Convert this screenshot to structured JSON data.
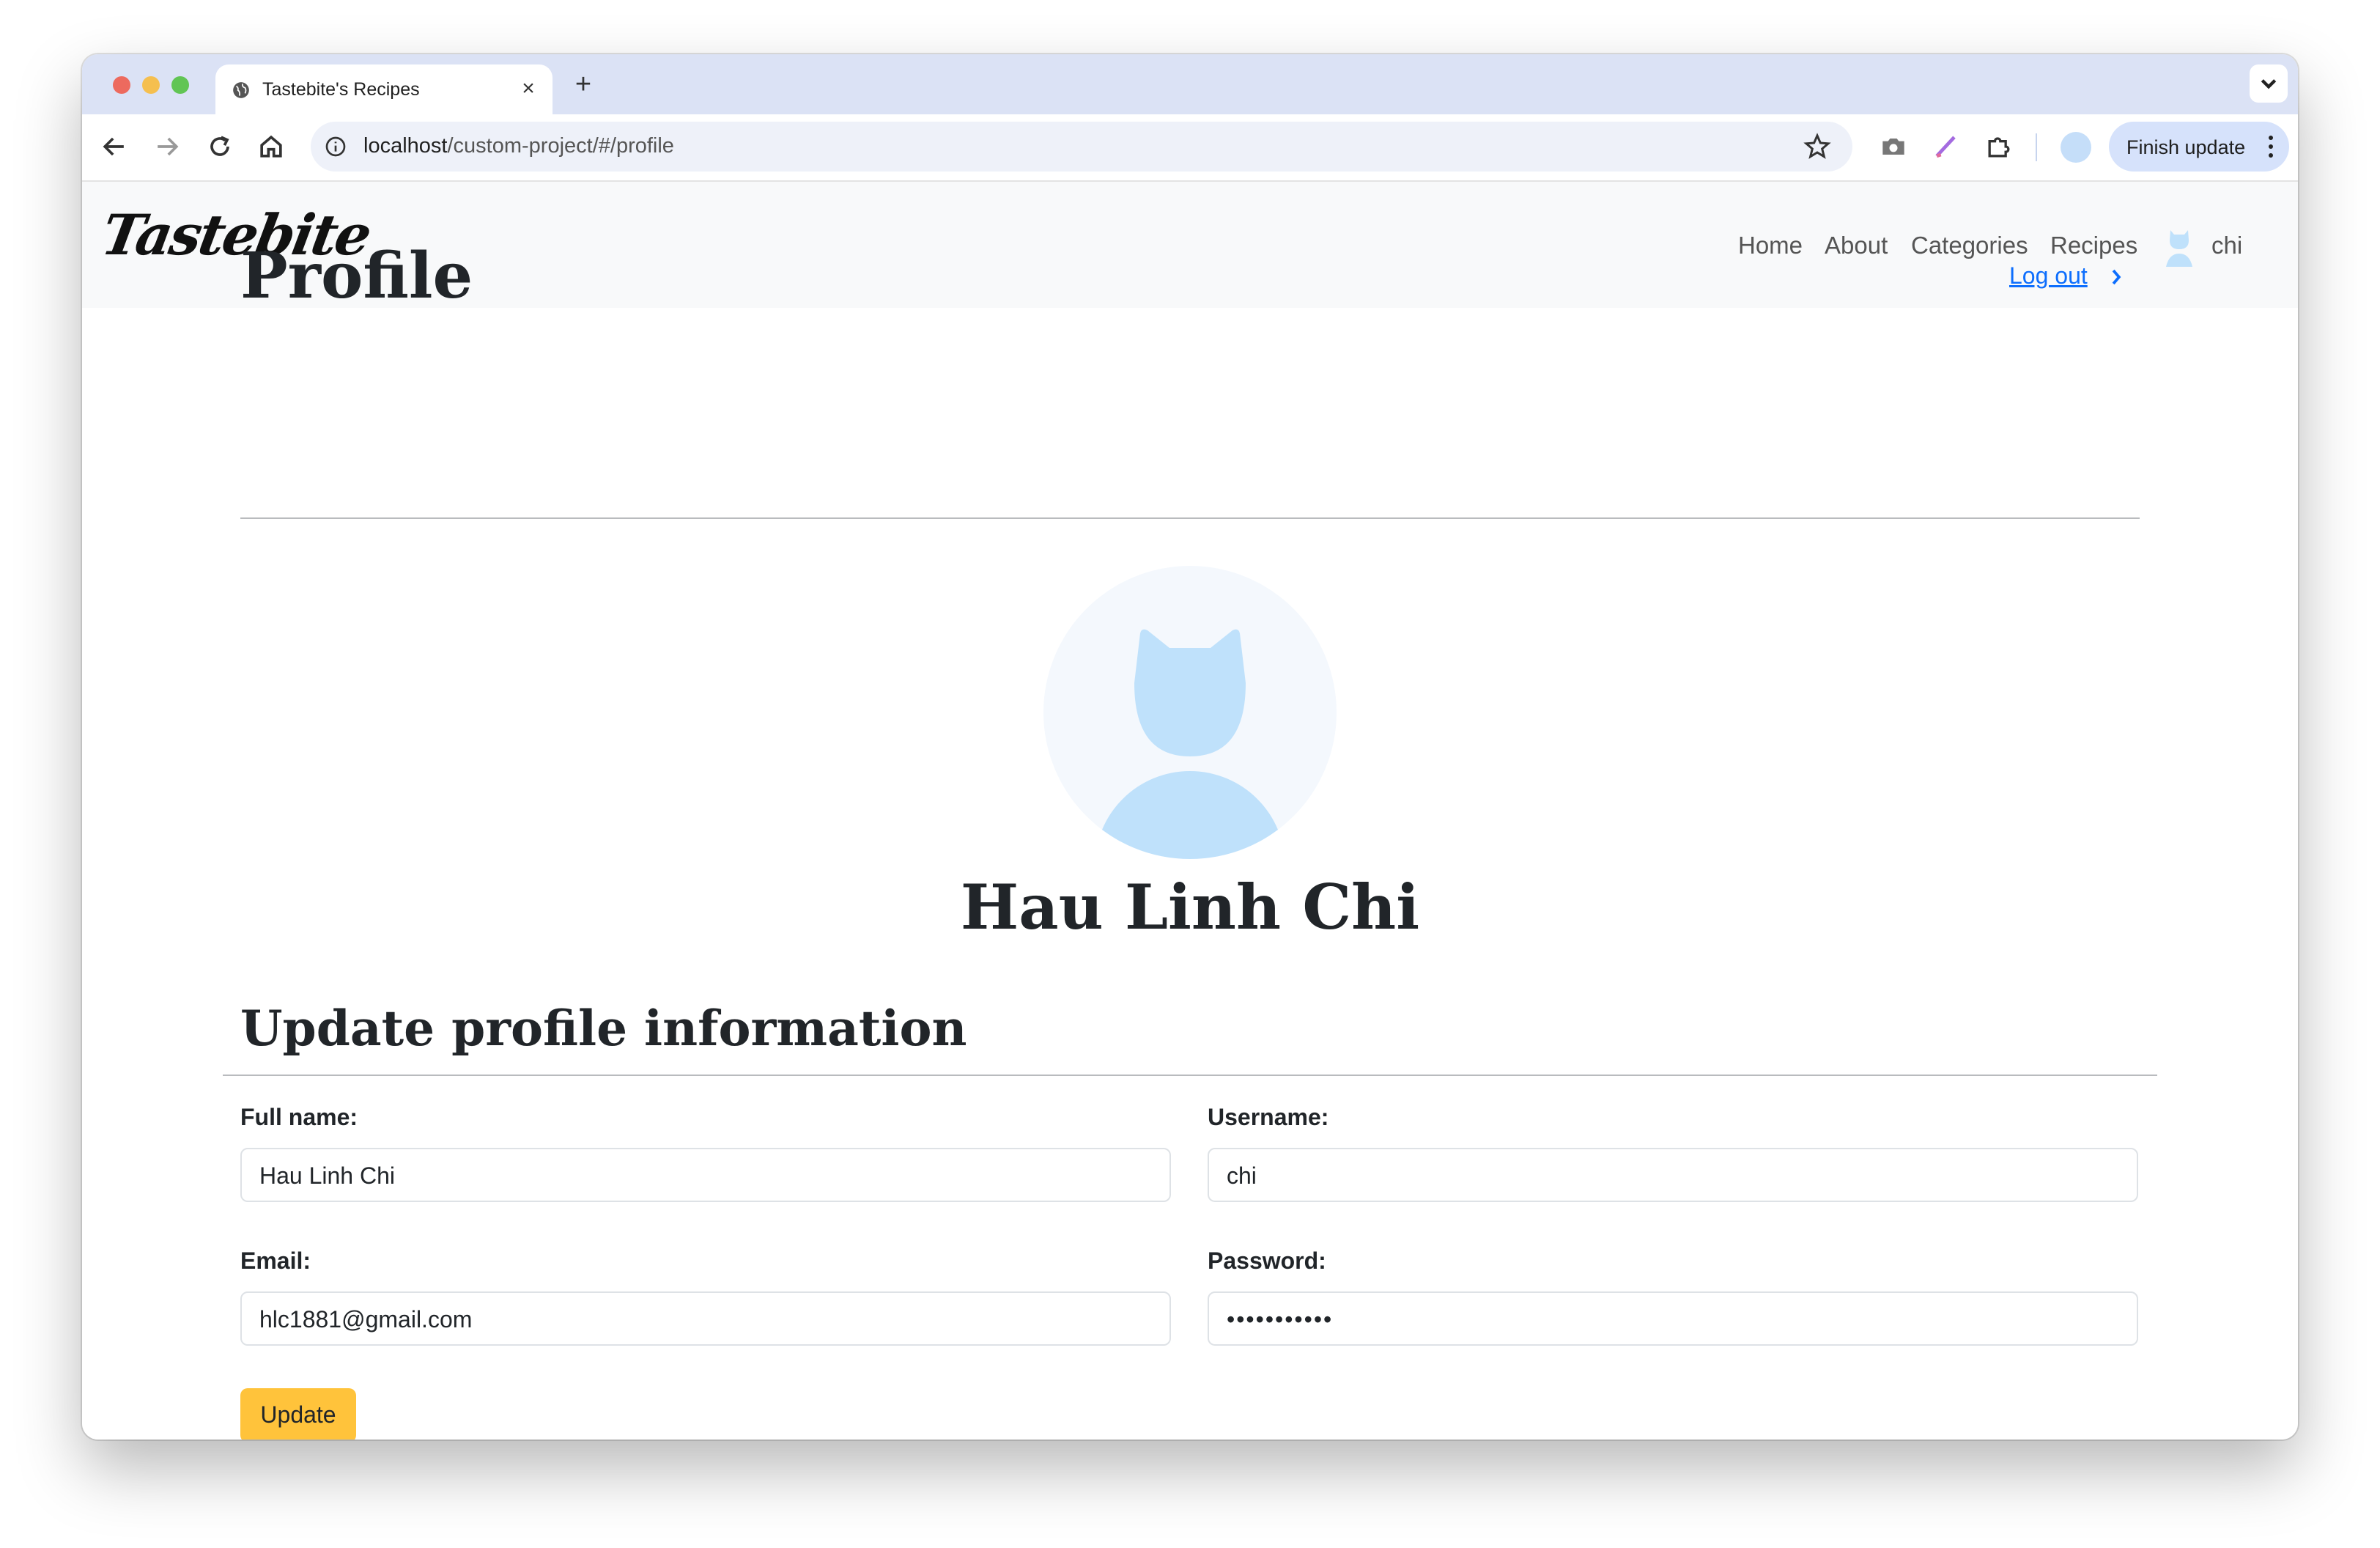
{
  "browser": {
    "tab_title": "Tastebite's Recipes",
    "url_host": "localhost",
    "url_path": "/custom-project/#/profile",
    "finish_update_label": "Finish update"
  },
  "navbar": {
    "logo": "Tastebite",
    "links": [
      "Home",
      "About",
      "Categories",
      "Recipes"
    ],
    "username": "chi"
  },
  "profile": {
    "title": "Profile",
    "logout_label": "Log out",
    "full_name": "Hau Linh Chi"
  },
  "form": {
    "section_title": "Update profile information",
    "full_name_label": "Full name:",
    "full_name_value": "Hau Linh Chi",
    "username_label": "Username:",
    "username_value": "chi",
    "email_label": "Email:",
    "email_value": "hlc1881@gmail.com",
    "password_label": "Password:",
    "password_value": "•••••••••••",
    "submit_label": "Update"
  },
  "colors": {
    "accent_button": "#ffc33b",
    "link": "#0d6efd",
    "avatar_bg": "#f4f8fd",
    "avatar_fill": "#bfe1fb"
  }
}
